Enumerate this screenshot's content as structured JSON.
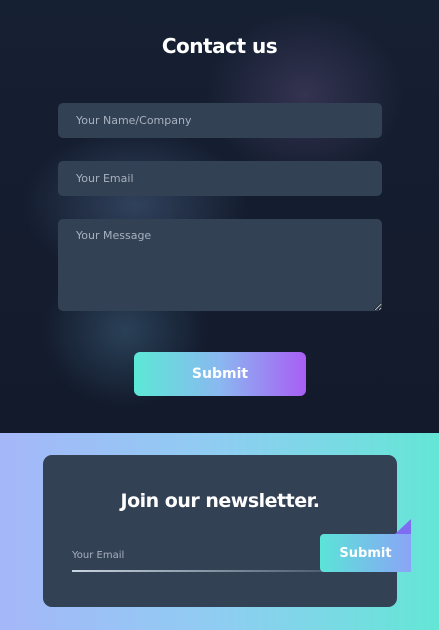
{
  "contact": {
    "title": "Contact us",
    "name_placeholder": "Your Name/Company",
    "email_placeholder": "Your Email",
    "message_placeholder": "Your Message",
    "submit_label": "Submit"
  },
  "newsletter": {
    "title": "Join our newsletter.",
    "email_placeholder": "Your Email",
    "submit_label": "Submit"
  },
  "colors": {
    "background_dark": "#121a2c",
    "field": "#334154",
    "card": "#334155",
    "gradient_teal": "#5ce8d6",
    "gradient_purple": "#a85ef4",
    "gradient_lavender": "#a5b7f9"
  }
}
